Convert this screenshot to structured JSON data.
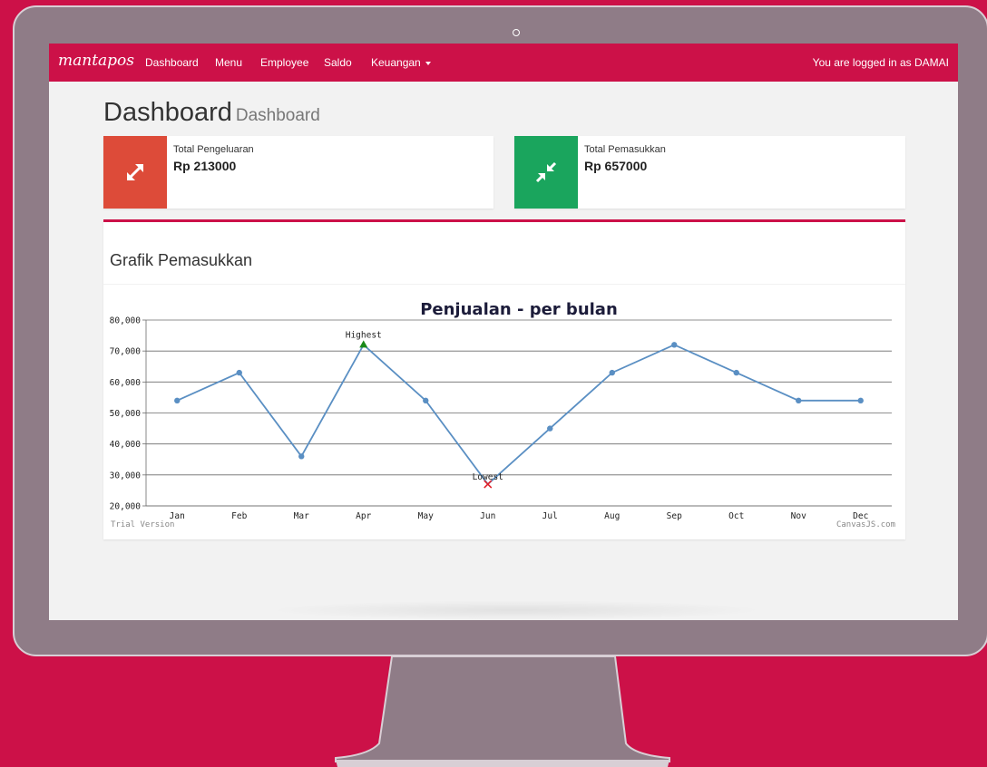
{
  "navbar": {
    "brand": "mantapos",
    "items": [
      "Dashboard",
      "Menu",
      "Employee",
      "Saldo",
      "Keuangan"
    ],
    "logged_in_text": "You are logged in as DAMAI"
  },
  "page": {
    "title": "Dashboard",
    "subtitle": "Dashboard"
  },
  "info_boxes": [
    {
      "label": "Total Pengeluaran",
      "value": "Rp 213000",
      "color": "#dd4b39",
      "icon": "expand-arrows-icon"
    },
    {
      "label": "Total Pemasukkan",
      "value": "Rp 657000",
      "color": "#1aa55d",
      "icon": "compress-arrows-icon"
    }
  ],
  "panel": {
    "title": "Grafik Pemasukkan"
  },
  "chart_data": {
    "type": "line",
    "title": "Penjualan - per bulan",
    "categories": [
      "Jan",
      "Feb",
      "Mar",
      "Apr",
      "May",
      "Jun",
      "Jul",
      "Aug",
      "Sep",
      "Oct",
      "Nov",
      "Dec"
    ],
    "values": [
      54000,
      63000,
      36000,
      72000,
      54000,
      27000,
      45000,
      63000,
      72000,
      63000,
      54000,
      54000
    ],
    "ylim": [
      20000,
      80000
    ],
    "yticks": [
      "20,000",
      "30,000",
      "40,000",
      "50,000",
      "60,000",
      "70,000",
      "80,000"
    ],
    "grid": true,
    "annotations": [
      {
        "index": 3,
        "label": "Highest",
        "marker": "triangle",
        "color": "#1a8a1a"
      },
      {
        "index": 5,
        "label": "Lowest",
        "marker": "cross",
        "color": "#e0202a"
      }
    ],
    "line_color": "#5a8fc3",
    "watermark_left": "Trial Version",
    "watermark_right": "CanvasJS.com"
  }
}
